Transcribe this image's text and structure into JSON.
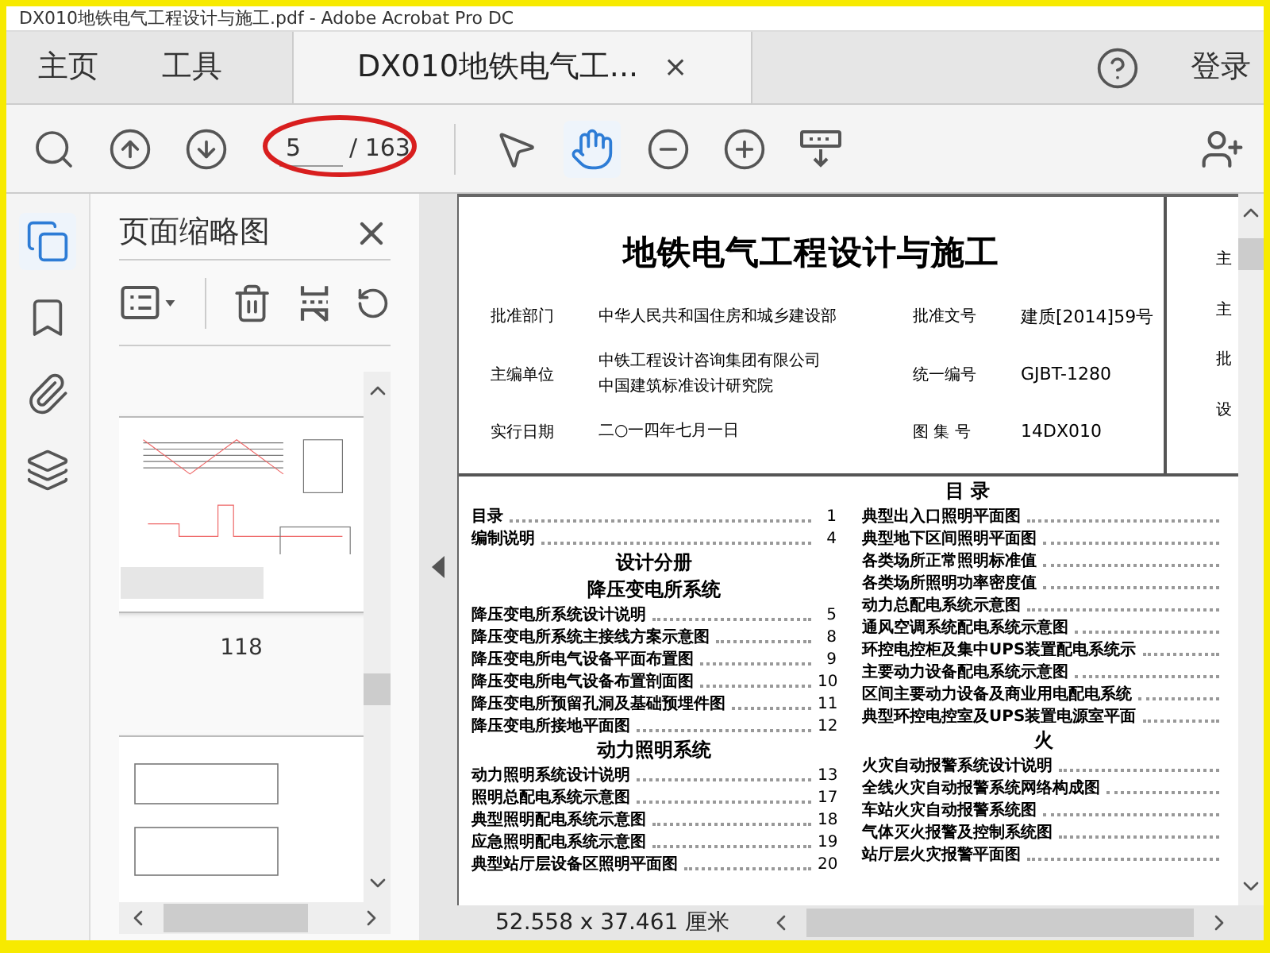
{
  "window": {
    "title": "DX010地铁电气工程设计与施工.pdf - Adobe Acrobat Pro DC"
  },
  "tabs": [
    {
      "label": "主页",
      "selected": false
    },
    {
      "label": "工具",
      "selected": false
    },
    {
      "label": "DX010地铁电气工...",
      "selected": true,
      "close": "×"
    }
  ],
  "header_right": {
    "login": "登录"
  },
  "toolbar": {
    "nav": [
      {
        "kind": "find",
        "selected": false
      },
      {
        "kind": "prev",
        "selected": false
      },
      {
        "kind": "next",
        "selected": false
      }
    ],
    "page_value": "5",
    "page_total": "/ 163",
    "tools": [
      {
        "kind": "pointer",
        "selected": false
      },
      {
        "kind": "hand",
        "selected": true
      },
      {
        "kind": "zoom_out",
        "selected": false
      },
      {
        "kind": "zoom_in",
        "selected": false
      },
      {
        "kind": "read_mode",
        "selected": false
      }
    ]
  },
  "rail": [
    {
      "kind": "pages",
      "selected": true
    },
    {
      "kind": "bookmarks",
      "selected": false
    },
    {
      "kind": "attachments",
      "selected": false
    },
    {
      "kind": "layers",
      "selected": false
    }
  ],
  "panel": {
    "title": "页面缩略图",
    "thumbnail_label": "118"
  },
  "document": {
    "title": "地铁电气工程设计与施工",
    "meta": [
      {
        "label": "批准部门",
        "value": [
          "中华人民共和国住房和城乡建设部"
        ],
        "label2": "批准文号",
        "value2": "建质[2014]59号"
      },
      {
        "label": "主编单位",
        "value": [
          "中铁工程设计咨询集团有限公司",
          "中国建筑标准设计研究院"
        ],
        "label2": "统一编号",
        "value2": "GJBT-1280"
      },
      {
        "label": "实行日期",
        "value": [
          "二○一四年七月一日"
        ],
        "label2": "图 集 号",
        "value2": "14DX010"
      }
    ],
    "side_chars": [
      "主",
      "主",
      "批",
      "设"
    ],
    "toc_heading": "目 录",
    "toc_left": [
      {
        "kind": "entry",
        "text": "目录",
        "page": "1"
      },
      {
        "kind": "entry",
        "text": "编制说明",
        "page": "4"
      },
      {
        "kind": "heading",
        "text": "设计分册"
      },
      {
        "kind": "heading",
        "text": "降压变电所系统"
      },
      {
        "kind": "entry",
        "text": "降压变电所系统设计说明",
        "page": "5"
      },
      {
        "kind": "entry",
        "text": "降压变电所系统主接线方案示意图",
        "page": "8"
      },
      {
        "kind": "entry",
        "text": "降压变电所电气设备平面布置图",
        "page": "9"
      },
      {
        "kind": "entry",
        "text": "降压变电所电气设备布置剖面图",
        "page": "10"
      },
      {
        "kind": "entry",
        "text": "降压变电所预留孔洞及基础预埋件图",
        "page": "11"
      },
      {
        "kind": "entry",
        "text": "降压变电所接地平面图",
        "page": "12"
      },
      {
        "kind": "heading",
        "text": "动力照明系统"
      },
      {
        "kind": "entry",
        "text": "动力照明系统设计说明",
        "page": "13"
      },
      {
        "kind": "entry",
        "text": "照明总配电系统示意图",
        "page": "17"
      },
      {
        "kind": "entry",
        "text": "典型照明配电系统示意图",
        "page": "18"
      },
      {
        "kind": "entry",
        "text": "应急照明配电系统示意图",
        "page": "19"
      },
      {
        "kind": "entry",
        "text": "典型站厅层设备区照明平面图",
        "page": "20"
      }
    ],
    "toc_right": [
      {
        "kind": "entry",
        "text": "典型出入口照明平面图"
      },
      {
        "kind": "entry",
        "text": "典型地下区间照明平面图"
      },
      {
        "kind": "entry",
        "text": "各类场所正常照明标准值"
      },
      {
        "kind": "entry",
        "text": "各类场所照明功率密度值"
      },
      {
        "kind": "entry",
        "text": "动力总配电系统示意图"
      },
      {
        "kind": "entry",
        "text": "通风空调系统配电系统示意图"
      },
      {
        "kind": "entry",
        "text": "环控电控柜及集中UPS装置配电系统示"
      },
      {
        "kind": "entry",
        "text": "主要动力设备配电系统示意图"
      },
      {
        "kind": "entry",
        "text": "区间主要动力设备及商业用电配电系统"
      },
      {
        "kind": "entry",
        "text": "典型环控电控室及UPS装置电源室平面"
      },
      {
        "kind": "heading",
        "text": "火"
      },
      {
        "kind": "entry",
        "text": "火灾自动报警系统设计说明"
      },
      {
        "kind": "entry",
        "text": "全线火灾自动报警系统网络构成图"
      },
      {
        "kind": "entry",
        "text": "车站火灾自动报警系统图"
      },
      {
        "kind": "entry",
        "text": "气体灭火报警及控制系统图"
      },
      {
        "kind": "entry",
        "text": "站厅层火灾报警平面图"
      }
    ]
  },
  "status": {
    "dimensions": "52.558 x 37.461 厘米"
  }
}
